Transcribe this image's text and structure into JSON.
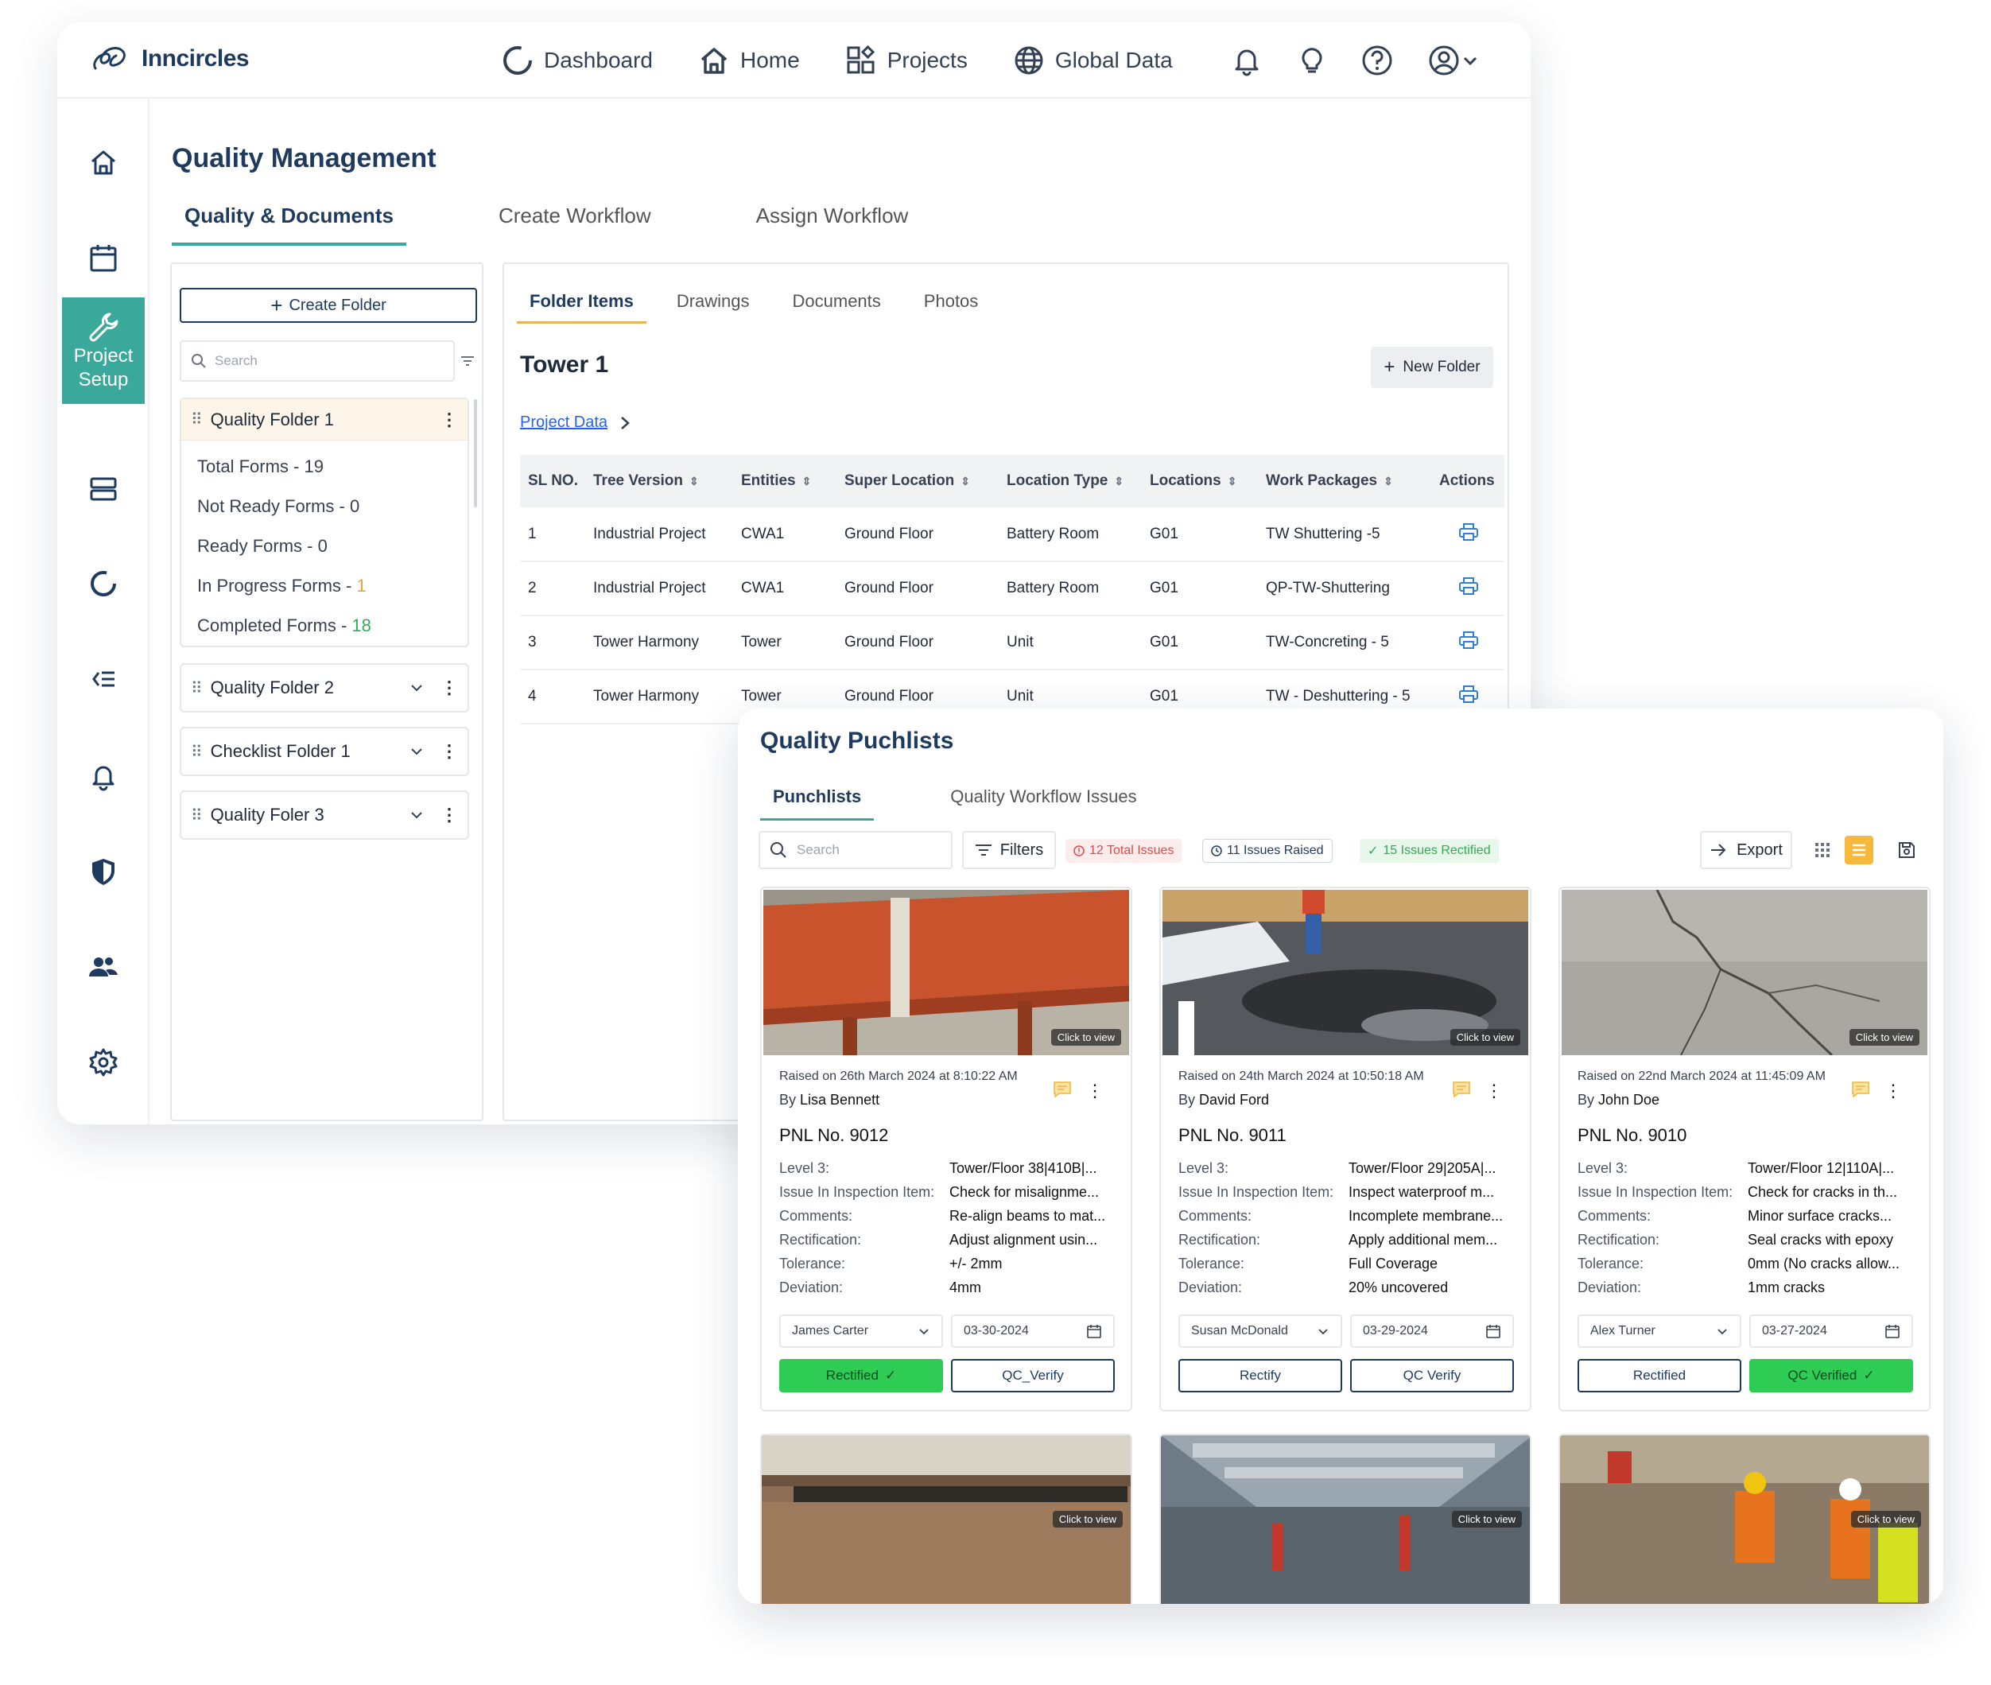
{
  "app": {
    "brand": "Inncircles"
  },
  "topnav": {
    "items": [
      {
        "label": "Dashboard",
        "icon": "dashboard-icon"
      },
      {
        "label": "Home",
        "icon": "home-icon"
      },
      {
        "label": "Projects",
        "icon": "projects-icon"
      },
      {
        "label": "Global Data",
        "icon": "globe-icon"
      }
    ],
    "icons": [
      "bell-icon",
      "lightbulb-icon",
      "help-icon",
      "user-icon"
    ]
  },
  "sidebar": {
    "active_label_1": "Project",
    "active_label_2": "Setup",
    "icons": [
      "home-icon",
      "calendar-icon",
      "wrench-icon",
      "server-icon",
      "progress-icon",
      "list-icon",
      "bell-icon",
      "shield-icon",
      "users-icon",
      "gear-icon"
    ]
  },
  "page": {
    "title": "Quality Management",
    "tabs": [
      "Quality & Documents",
      "Create Workflow",
      "Assign Workflow"
    ]
  },
  "folders": {
    "create_label": "Create Folder",
    "search_placeholder": "Search",
    "open_folder": {
      "name": "Quality Folder 1",
      "stats": [
        {
          "label": "Total Forms - ",
          "value": "19",
          "color": "#374151"
        },
        {
          "label": "Not Ready Forms - ",
          "value": "0",
          "color": "#374151"
        },
        {
          "label": "Ready Forms - ",
          "value": "0",
          "color": "#374151"
        },
        {
          "label": "In Progress Forms - ",
          "value": "1",
          "color": "#e8a33d"
        },
        {
          "label": "Completed Forms - ",
          "value": "18",
          "color": "#3aa55a"
        }
      ]
    },
    "others": [
      "Quality Folder 2",
      "Checklist Folder 1",
      "Quality Foler 3"
    ]
  },
  "content": {
    "subtabs": [
      "Folder Items",
      "Drawings",
      "Documents",
      "Photos"
    ],
    "heading": "Tower 1",
    "new_folder_label": "New Folder",
    "breadcrumb": "Project Data",
    "columns": [
      "SL NO.",
      "Tree Version",
      "Entities",
      "Super Location",
      "Location Type",
      "Locations",
      "Work Packages",
      "Actions"
    ],
    "rows": [
      [
        "1",
        "Industrial Project",
        "CWA1",
        "Ground Floor",
        "Battery Room",
        "G01",
        "TW Shuttering -5"
      ],
      [
        "2",
        "Industrial Project",
        "CWA1",
        "Ground Floor",
        "Battery Room",
        "G01",
        "QP-TW-Shuttering"
      ],
      [
        "3",
        "Tower Harmony",
        "Tower",
        "Ground Floor",
        "Unit",
        "G01",
        "TW-Concreting - 5"
      ],
      [
        "4",
        "Tower Harmony",
        "Tower",
        "Ground Floor",
        "Unit",
        "G01",
        "TW - Deshuttering - 5"
      ]
    ]
  },
  "punchlist": {
    "title": "Quality Puchlists",
    "tabs": [
      "Punchlists",
      "Quality Workflow Issues"
    ],
    "search_placeholder": "Search",
    "filters_label": "Filters",
    "badges": {
      "total": "12 Total Issues",
      "raised": "11 Issues Raised",
      "rectified": "15 Issues Rectified"
    },
    "export_label": "Export",
    "click_to_view": "Click to view",
    "labels": [
      "Level 3:",
      "Issue In Inspection Item:",
      "Comments:",
      "Rectification:",
      "Tolerance:",
      "Deviation:"
    ],
    "cards": [
      {
        "raised": "Raised on 26th March 2024 at 8:10:22 AM",
        "by_prefix": "By ",
        "by": "Lisa Bennett",
        "pnl": "PNL No. 9012",
        "values": [
          "Tower/Floor 38|410B|...",
          "Check for misalignme...",
          "Re-align beams to mat...",
          "Adjust alignment usin...",
          "+/- 2mm",
          "4mm"
        ],
        "assignee": "James Carter",
        "date": "03-30-2024",
        "btn1": "Rectified",
        "btn2": "QC_Verify"
      },
      {
        "raised": "Raised on 24th March 2024 at 10:50:18 AM",
        "by_prefix": "By ",
        "by": "David Ford",
        "pnl": "PNL No. 9011",
        "values": [
          "Tower/Floor 29|205A|...",
          "Inspect waterproof m...",
          "Incomplete membrane...",
          "Apply additional mem...",
          "Full Coverage",
          "20% uncovered"
        ],
        "assignee": "Susan McDonald",
        "date": "03-29-2024",
        "btn1": "Rectify",
        "btn2": "QC Verify"
      },
      {
        "raised": "Raised on 22nd March 2024 at 11:45:09 AM",
        "by_prefix": "By ",
        "by": "John Doe",
        "pnl": "PNL No. 9010",
        "values": [
          "Tower/Floor 12|110A|...",
          "Check for cracks in th...",
          "Minor surface cracks...",
          "Seal cracks with epoxy",
          "0mm (No cracks allow...",
          "1mm cracks"
        ],
        "assignee": "Alex Turner",
        "date": "03-27-2024",
        "btn1": "Rectified",
        "btn2": "QC Verified"
      }
    ]
  },
  "colors": {
    "brand": "#1e3a5f",
    "accent": "#3aa89a",
    "success": "#2ecc54",
    "warning": "#e8b458"
  }
}
